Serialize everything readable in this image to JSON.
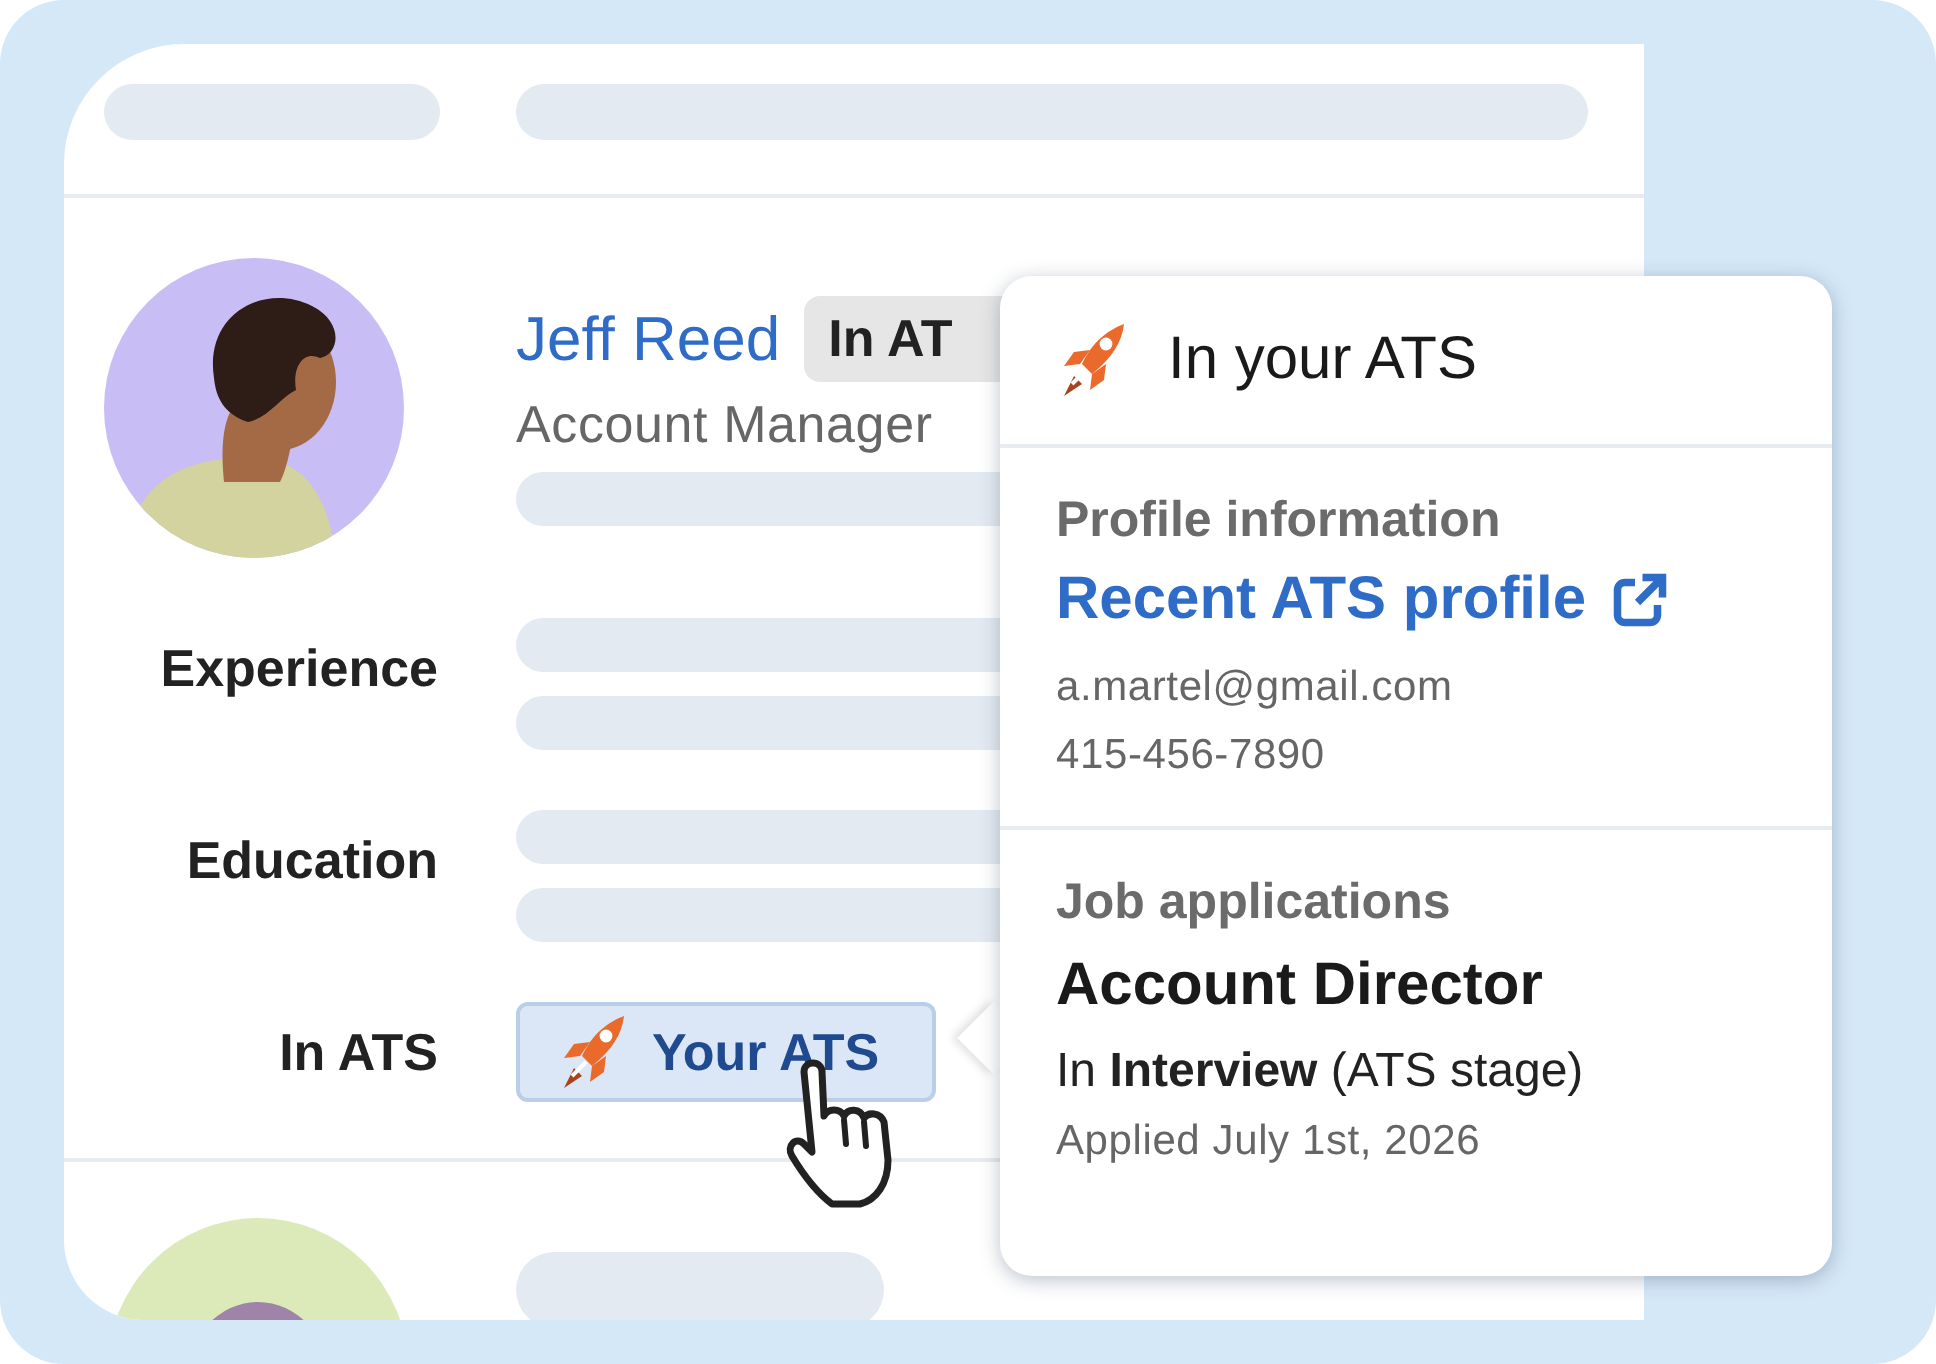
{
  "profile": {
    "name": "Jeff Reed",
    "badge": "In AT",
    "title": "Account Manager"
  },
  "fields": [
    {
      "label": "Experience",
      "kind": "skeleton"
    },
    {
      "label": "Education",
      "kind": "skeleton"
    },
    {
      "label": "In ATS",
      "kind": "ats_button",
      "button": "Your ATS"
    }
  ],
  "popover": {
    "title": "In your ATS",
    "sections": [
      {
        "heading": "Profile information",
        "link": "Recent ATS profile",
        "email": "a.martel@gmail.com",
        "phone": "415-456-7890"
      },
      {
        "heading": "Job applications",
        "job_title": "Account Director",
        "stage": "In **Interview** (ATS stage)",
        "applied": "Applied July 1st, 2026"
      }
    ]
  }
}
